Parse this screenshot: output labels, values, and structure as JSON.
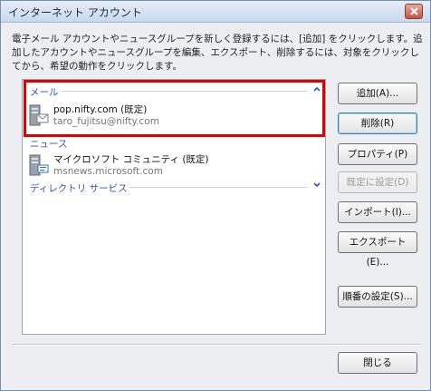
{
  "window": {
    "title": "インターネット アカウント"
  },
  "description": "電子メール アカウントやニュースグループを新しく登録するには、[追加] をクリックします。追加したアカウントやニュースグループを編集、エクスポート、削除するには、対象をクリックしてから、希望の動作をクリックします。",
  "groups": [
    {
      "label": "メール",
      "accounts": [
        {
          "name": "pop.nifty.com (既定)",
          "sub": "taro_fujitsu@nifty.com"
        }
      ]
    },
    {
      "label": "ニュース",
      "accounts": [
        {
          "name": "マイクロソフト コミュニティ (既定)",
          "sub": "msnews.microsoft.com"
        }
      ]
    },
    {
      "label": "ディレクトリ サービス",
      "accounts": []
    }
  ],
  "buttons": {
    "add": "追加(A)...",
    "delete": "削除(R)",
    "properties": "プロパティ(P)",
    "set_default": "既定に設定(D)",
    "import": "インポート(I)...",
    "export": "エクスポート(E)...",
    "order": "順番の設定(S)...",
    "close": "閉じる"
  },
  "colors": {
    "highlight": "#e00000",
    "group_header": "#2a56b8"
  }
}
